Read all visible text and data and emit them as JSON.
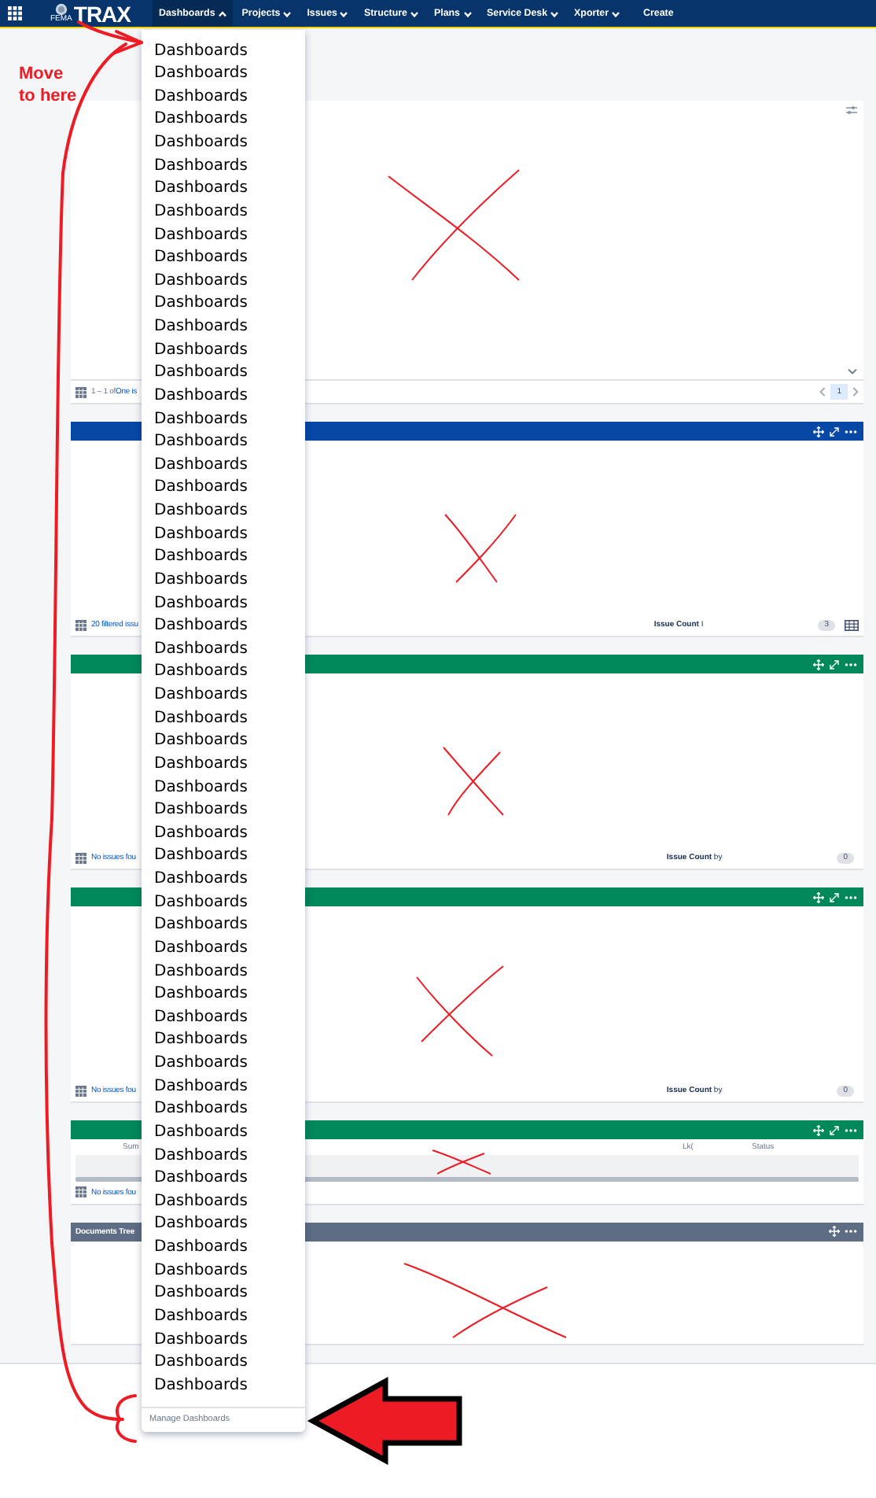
{
  "nav": {
    "seal_text": "FEMA",
    "logo": "TRAX",
    "items": [
      {
        "label": "Dashboards",
        "kind": "menu",
        "selected": true
      },
      {
        "label": "Projects",
        "kind": "menu",
        "selected": false
      },
      {
        "label": "Issues",
        "kind": "menu",
        "selected": false
      },
      {
        "label": "Structure",
        "kind": "menu",
        "selected": false
      },
      {
        "label": "Plans",
        "kind": "menu",
        "selected": false
      },
      {
        "label": "Service Desk",
        "kind": "menu",
        "selected": false
      },
      {
        "label": "Xporter",
        "kind": "menu",
        "selected": false
      },
      {
        "label": "Create",
        "kind": "button",
        "selected": false
      }
    ]
  },
  "dashboard_menu": {
    "items": [
      "Dashboards",
      "Dashboards",
      "Dashboards",
      "Dashboards",
      "Dashboards",
      "Dashboards",
      "Dashboards",
      "Dashboards",
      "Dashboards",
      "Dashboards",
      "Dashboards",
      "Dashboards",
      "Dashboards",
      "Dashboards",
      "Dashboards",
      "Dashboards",
      "Dashboards",
      "Dashboards",
      "Dashboards",
      "Dashboards",
      "Dashboards",
      "Dashboards",
      "Dashboards",
      "Dashboards",
      "Dashboards",
      "Dashboards",
      "Dashboards",
      "Dashboards",
      "Dashboards",
      "Dashboards",
      "Dashboards",
      "Dashboards",
      "Dashboards",
      "Dashboards",
      "Dashboards",
      "Dashboards",
      "Dashboards",
      "Dashboards",
      "Dashboards",
      "Dashboards",
      "Dashboards",
      "Dashboards",
      "Dashboards",
      "Dashboards",
      "Dashboards",
      "Dashboards",
      "Dashboards",
      "Dashboards",
      "Dashboards",
      "Dashboards",
      "Dashboards",
      "Dashboards",
      "Dashboards",
      "Dashboards",
      "Dashboards",
      "Dashboards",
      "Dashboards",
      "Dashboards",
      "Dashboards"
    ],
    "footer_link": "Manage Dashboards"
  },
  "panels": [
    {
      "kind": "issue_list",
      "color": "#ffffff",
      "footer_text": "1 – 1 of",
      "footer_link": "One is",
      "pages": [
        {
          "label": "1",
          "selected": true
        }
      ]
    },
    {
      "kind": "chart",
      "color": "#0747a6",
      "footer_link": "20 filtered issu",
      "stat_label": "**Issue Count** I",
      "count": "3"
    },
    {
      "kind": "chart",
      "color": "#00875a",
      "footer_link": "No issues fou",
      "stat_label": "**Issue Count** by",
      "count": "0"
    },
    {
      "kind": "chart",
      "color": "#00875a",
      "footer_link": "No issues fou",
      "stat_label": "**Issue Count** by",
      "count": "0"
    },
    {
      "kind": "table",
      "color": "#00875a",
      "columns": [
        "Sum",
        "Lk(",
        "Status"
      ],
      "footer_link": "No issues fou"
    },
    {
      "kind": "tree",
      "color": "#5e6c84",
      "title": "Documents Tree"
    }
  ],
  "annotation": {
    "note": "Move to here"
  }
}
